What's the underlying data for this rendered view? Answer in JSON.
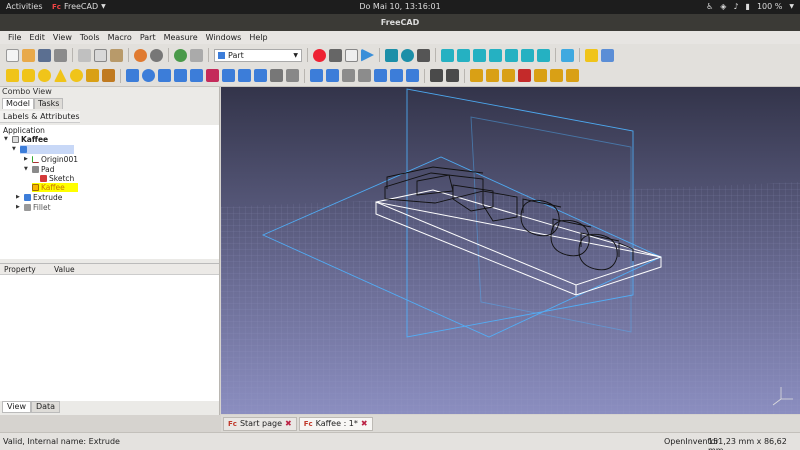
{
  "topbar": {
    "activities": "Activities",
    "app_name": "FreeCAD",
    "clock": "Do Mai 10, 13:16:01",
    "battery": "100 %"
  },
  "window": {
    "title": "FreeCAD"
  },
  "menu": [
    "File",
    "Edit",
    "View",
    "Tools",
    "Macro",
    "Part",
    "Measure",
    "Windows",
    "Help"
  ],
  "toolbar": {
    "workbench": "Part"
  },
  "combo": {
    "title": "Combo View",
    "tabs": [
      "Model",
      "Tasks"
    ],
    "labels_header": "Labels & Attributes",
    "tree": [
      {
        "label": "Application"
      },
      {
        "label": "Kaffee"
      },
      {
        "label": ""
      },
      {
        "label": "Origin001"
      },
      {
        "label": "Pad"
      },
      {
        "label": "Sketch"
      },
      {
        "label": "Kaffee"
      },
      {
        "label": "Extrude"
      },
      {
        "label": "Fillet"
      }
    ],
    "property_headers": [
      "Property",
      "Value"
    ],
    "bottom_tabs": [
      "View",
      "Data"
    ]
  },
  "doc_tabs": [
    "Start page",
    "Kaffee : 1*"
  ],
  "status": {
    "message": "Valid, Internal name: Extrude",
    "navigation": "OpenInventor",
    "dimensions": "151,23 mm x 86,62 mm"
  },
  "colors": {
    "tree_selected": "#c8d8f7",
    "tree_highlight": "#ffff00",
    "view_top": "#33344a",
    "view_bottom": "#8b8ec0"
  }
}
